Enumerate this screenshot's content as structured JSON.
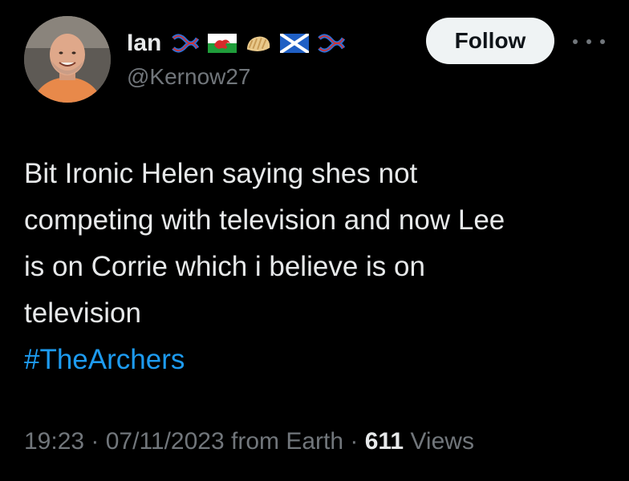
{
  "author": {
    "display_name": "Ian",
    "handle": "@Kernow27",
    "header_icons": [
      "cornish-tartan-ribbon-icon",
      "wales-flag-icon",
      "cornish-pasty-icon",
      "scotland-flag-icon",
      "cornish-tartan-ribbon-icon"
    ]
  },
  "actions": {
    "follow_label": "Follow",
    "more_icon": "more-horizontal-icon"
  },
  "tweet": {
    "lines": [
      "Bit Ironic Helen saying shes not",
      "competing with television and now Lee",
      "is on Corrie which i believe is on",
      "television"
    ],
    "hashtag": "#TheArchers"
  },
  "meta": {
    "time": "19:23",
    "sep1": " · ",
    "date": "07/11/2023",
    "source": " from Earth",
    "sep2": " · ",
    "views_count": "611",
    "views_label": " Views"
  },
  "colors": {
    "background": "#000000",
    "text": "#e7e9ea",
    "secondary": "#71767b",
    "link": "#1d9bf0",
    "follow_bg": "#eff3f4"
  }
}
